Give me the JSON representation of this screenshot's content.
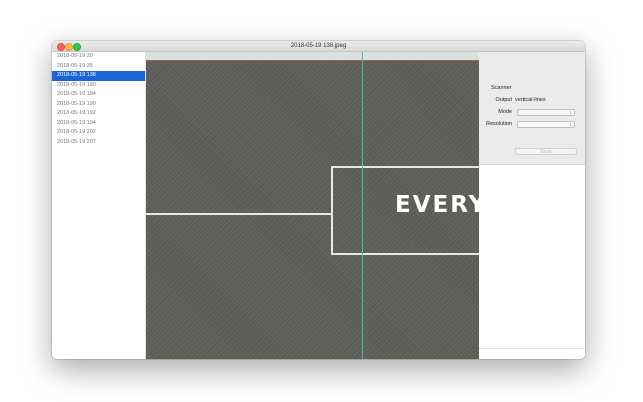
{
  "window": {
    "title": "2018-05-19 138.jpeg"
  },
  "sidebar": {
    "items": [
      {
        "label": "2018-05-19 30",
        "selected": false
      },
      {
        "label": "2018-05-19 35",
        "selected": false
      },
      {
        "label": "2018-05-19 138",
        "selected": true
      },
      {
        "label": "2018-05-19 180",
        "selected": false
      },
      {
        "label": "2018-05-19 184",
        "selected": false
      },
      {
        "label": "2018-05-19 190",
        "selected": false
      },
      {
        "label": "2018-05-19 192",
        "selected": false
      },
      {
        "label": "2018-05-19 194",
        "selected": false
      },
      {
        "label": "2018-05-19 202",
        "selected": false
      },
      {
        "label": "2018-05-19 207",
        "selected": false
      }
    ]
  },
  "image": {
    "overlay_text": "EVERY"
  },
  "panel": {
    "heading": "Scanner",
    "output_label": "Output",
    "output_value": "vertical-lines",
    "mode_label": "Mode",
    "mode_value": "",
    "resolution_label": "Resolution",
    "resolution_value": "",
    "scan_label": "Scan"
  },
  "colors": {
    "selection": "#1a66d6",
    "scanner_line": "#4fb8a8",
    "image_background": "#5c5f57"
  },
  "icons": {
    "close": "close-icon",
    "minimize": "minimize-icon",
    "maximize": "maximize-icon",
    "popup": "chevron-updown-icon"
  }
}
